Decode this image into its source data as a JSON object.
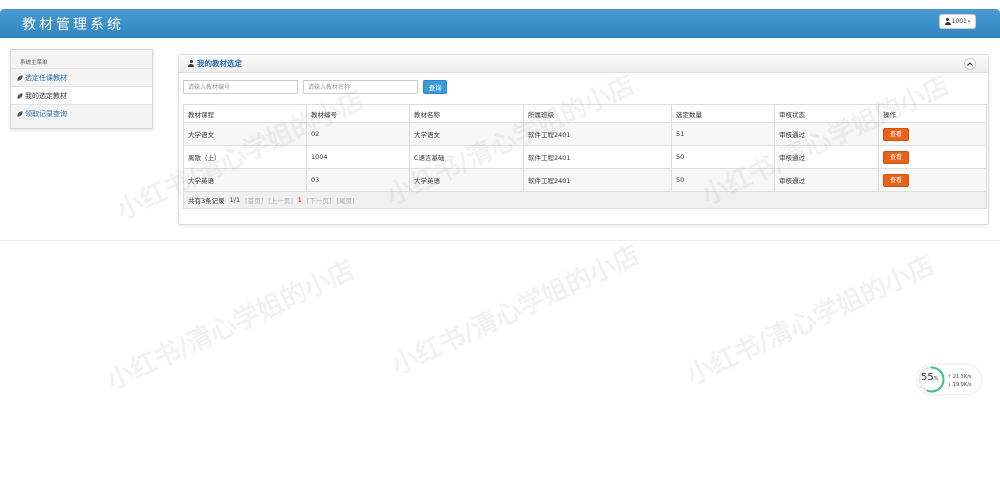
{
  "app": {
    "title": "教材管理系统",
    "user": "1001"
  },
  "sidebar": {
    "heading": "系统主菜单",
    "items": [
      {
        "label": "选定任课教材",
        "active": false
      },
      {
        "label": "我的选定教材",
        "active": true
      },
      {
        "label": "领取记录查询",
        "active": false
      }
    ]
  },
  "panel": {
    "title": "我的教材选定"
  },
  "search": {
    "code_placeholder": "请输入教材编号",
    "name_placeholder": "请输入教材名称",
    "button_label": "查询"
  },
  "table": {
    "headers": [
      "教材课程",
      "教材编号",
      "教材名称",
      "所属班级",
      "选定数量",
      "审核状态",
      "操作"
    ],
    "rows": [
      {
        "course": "大学语文",
        "code": "02",
        "name": "大学语文",
        "class": "软件工程2401",
        "qty": "51",
        "status": "审核通过",
        "action": "查看"
      },
      {
        "course": "离散（上）",
        "code": "1004",
        "name": "C语言基础",
        "class": "软件工程2401",
        "qty": "50",
        "status": "审核通过",
        "action": "查看"
      },
      {
        "course": "大学英语",
        "code": "03",
        "name": "大学英语",
        "class": "软件工程2401",
        "qty": "50",
        "status": "审核通过",
        "action": "查看"
      }
    ]
  },
  "pager": {
    "summary": "共有3条记录",
    "pages": "1/1",
    "first": "[首页]",
    "prev": "[上一页]",
    "current": "1",
    "next": "[下一页]",
    "last": "[尾页]"
  },
  "speed_widget": {
    "percent": "55",
    "percent_unit": "%",
    "up": "21.5",
    "down": "19.9",
    "unit": "K/s"
  },
  "watermark": "小红书/清心学姐的小店",
  "colors": {
    "header_blue": "#2f86c2",
    "link_blue": "#2a6cb0",
    "view_orange": "#e8621b",
    "query_blue": "#3b9ad9"
  }
}
